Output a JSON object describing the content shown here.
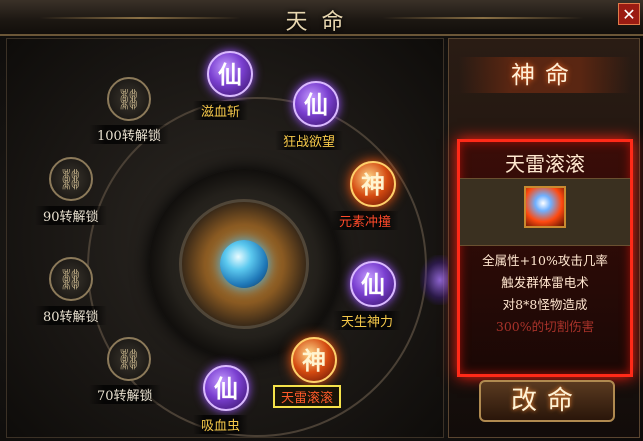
{
  "window": {
    "title": "天命",
    "close": "✕"
  },
  "nodes": [
    {
      "kind": "xian",
      "glyph": "仙",
      "label": "滋血斩"
    },
    {
      "kind": "xian",
      "glyph": "仙",
      "label": "狂战欲望"
    },
    {
      "kind": "shen",
      "glyph": "神",
      "label": "元素冲撞"
    },
    {
      "kind": "xian",
      "glyph": "仙",
      "label": "天生神力"
    },
    {
      "kind": "shen",
      "glyph": "神",
      "label": "天雷滚滚",
      "selected": true
    },
    {
      "kind": "xian",
      "glyph": "仙",
      "label": "吸血虫"
    }
  ],
  "locks": [
    {
      "label": "100转解锁"
    },
    {
      "label": "90转解锁"
    },
    {
      "label": "80转解锁"
    },
    {
      "label": "70转解锁"
    }
  ],
  "side": {
    "header": "神命",
    "card": {
      "title": "天雷滚滚",
      "icon": "thunder-skill-icon",
      "desc1": "全属性+10%攻击几率",
      "desc2": "触发群体雷电术",
      "desc3": "对8*8怪物造成",
      "desc4": "300%的切割伤害"
    },
    "button": "改命"
  },
  "colors": {
    "xian": "#7a3fd0",
    "shen": "#d44a10",
    "highlight": "#f5e24a",
    "card_border": "#ff2a18"
  }
}
